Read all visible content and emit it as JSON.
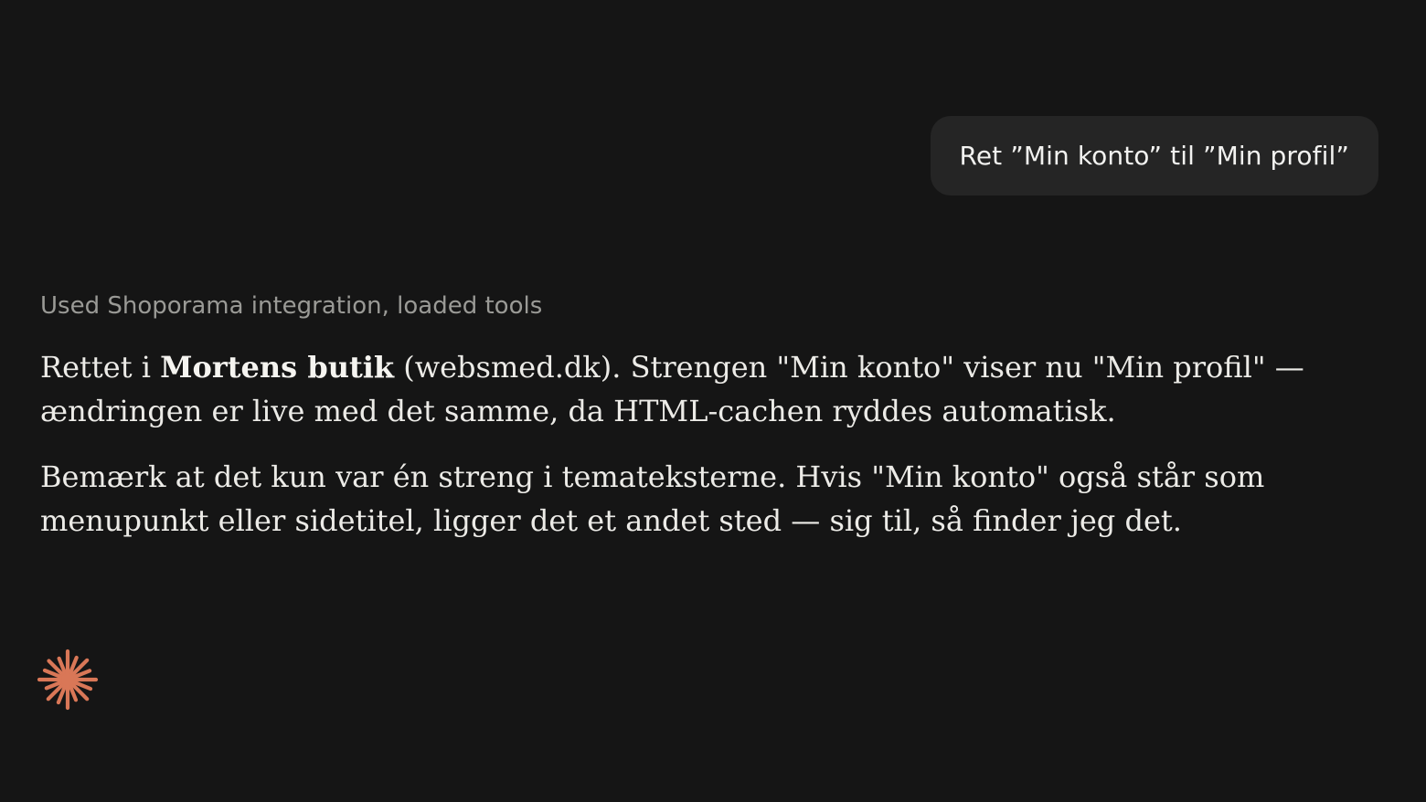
{
  "user_message": {
    "text": "Ret ”Min konto” til ”Min profil”"
  },
  "assistant_message": {
    "tool_status": "Used Shoporama integration, loaded tools",
    "paragraph1": {
      "prefix": "Rettet i ",
      "bold": "Mortens butik",
      "suffix": " (websmed.dk). Strengen \"Min konto\" viser nu \"Min profil\" — ændringen er live med det samme, da HTML-cachen ryddes automatisk."
    },
    "paragraph2": "Bemærk at det kun var én streng i temateksterne. Hvis \"Min konto\" også står som menupunkt eller sidetitel, ligger det et andet sted — sig til, så finder jeg det."
  },
  "icons": {
    "spark": "spark-asterisk-icon",
    "accent_color": "#d97757"
  },
  "colors": {
    "background": "#151515",
    "user_bubble": "#252525",
    "text": "#ecebe7",
    "muted_text": "#9a9a96"
  }
}
